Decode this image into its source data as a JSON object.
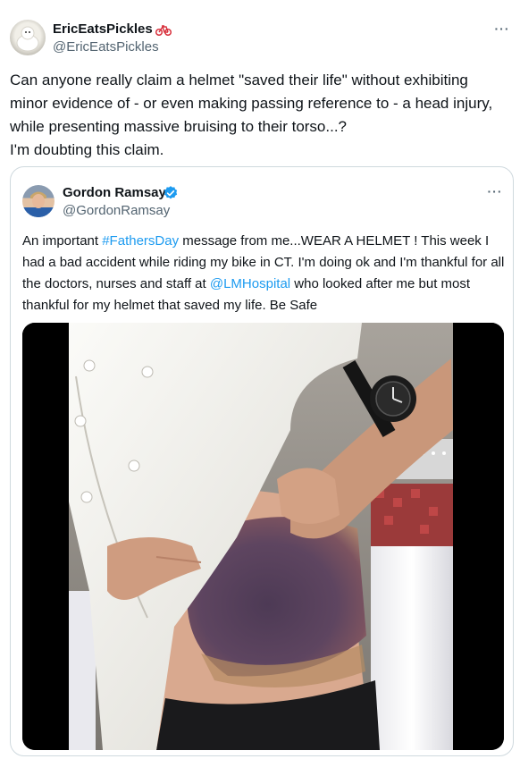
{
  "post": {
    "author_name": "EricEatsPickles",
    "author_handle": "@EricEatsPickles",
    "name_emoji_icon": "bicycle-icon",
    "more_label": "···",
    "text_lines": [
      "Can anyone really claim a helmet \"saved their life\" without exhibiting",
      "minor evidence of - or even making passing reference to - a head injury,",
      "while presenting massive bruising to their torso...?",
      "I'm doubting this claim."
    ]
  },
  "quote": {
    "author_name": "Gordon Ramsay",
    "author_handle": "@GordonRamsay",
    "verified_icon": "verified-badge-icon",
    "more_label": "···",
    "text_before_hashtag": "An important ",
    "hashtag": "#FathersDay",
    "text_middle": " message from me...WEAR A HELMET ! This week I had a bad accident while riding my bike in CT. I'm doing ok and I'm thankful for all the doctors, nurses and staff at ",
    "mention": "@LMHospital",
    "text_after_mention": " who looked after me but most thankful for my helmet that saved my life. Be Safe",
    "media_description_icon": "photo-image"
  },
  "colors": {
    "link": "#1d9bf0",
    "secondary_text": "#536471",
    "border": "#cfd9de",
    "verified": "#1d9bf0"
  }
}
